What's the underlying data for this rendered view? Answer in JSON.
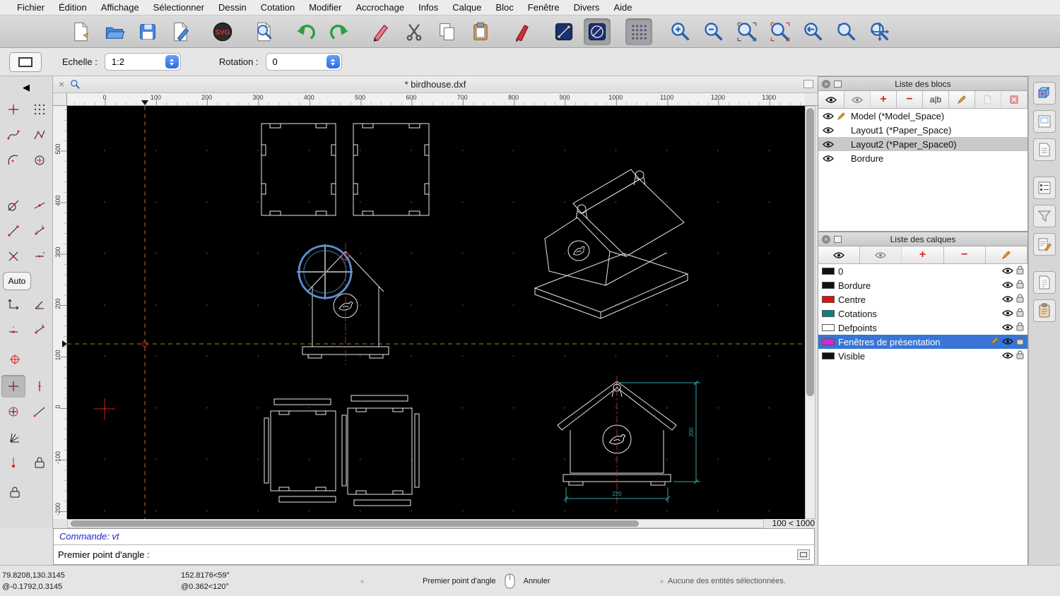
{
  "colors": {
    "accent_blue": "#3478f6",
    "selection_blue": "#3875d7",
    "canvas_bg": "#000000",
    "line_white": "#e8e8e8",
    "dim_cyan": "#2fa8a8",
    "center_red": "#cc3333",
    "construction_orange": "#b97425",
    "snap_blue": "#5f93d8"
  },
  "menubar": {
    "items": [
      "Fichier",
      "Édition",
      "Affichage",
      "Sélectionner",
      "Dessin",
      "Cotation",
      "Modifier",
      "Accrochage",
      "Infos",
      "Calque",
      "Bloc",
      "Fenêtre",
      "Divers",
      "Aide"
    ]
  },
  "glyphs": {
    "svg_badge": "SVG",
    "back_arrow": "◀",
    "plus": "+",
    "minus": "−",
    "rename": "a|b",
    "close": "×",
    "auto": "Auto"
  },
  "options_bar": {
    "scale_label": "Echelle :",
    "scale_value": "1:2",
    "rotation_label": "Rotation :",
    "rotation_value": "0"
  },
  "document": {
    "tab_title": "* birdhouse.dxf",
    "zoom_range": "100 < 1000"
  },
  "rulers": {
    "horizontal": [
      "0",
      "100",
      "200",
      "300",
      "400",
      "500",
      "600",
      "700",
      "800",
      "900",
      "1000",
      "1100",
      "1200",
      "1300"
    ],
    "vertical": [
      "500",
      "400",
      "300",
      "200",
      "100",
      "0",
      "-100",
      "-200"
    ]
  },
  "drawing": {
    "dim_width": "220",
    "dim_height": "200"
  },
  "blocks_panel": {
    "title": "Liste des blocs",
    "rows": [
      {
        "label": "Model (*Model_Space)",
        "pencil": true
      },
      {
        "label": "Layout1 (*Paper_Space)"
      },
      {
        "label": "Layout2 (*Paper_Space0)",
        "selected": true
      },
      {
        "label": "Bordure"
      }
    ]
  },
  "layers_panel": {
    "title": "Liste des calques",
    "rows": [
      {
        "label": "0",
        "color": "#111111"
      },
      {
        "label": "Bordure",
        "color": "#111111"
      },
      {
        "label": "Centre",
        "color": "#e01010"
      },
      {
        "label": "Cotations",
        "color": "#0e8080"
      },
      {
        "label": "Defpoints",
        "color": "#ffffff"
      },
      {
        "label": "Fenêtres de présentation",
        "color": "#dd22dd",
        "selected": true,
        "pencil": true
      },
      {
        "label": "Visible",
        "color": "#111111"
      }
    ]
  },
  "command": {
    "history": "Commande: vt",
    "prompt_label": "Premier point d'angle :"
  },
  "statusbar": {
    "abs_coord": "79.8208,130.3145",
    "rel_coord": "@-0.1792,0.3145",
    "abs_polar": "152.8176<59°",
    "rel_polar": "@0.362<120°",
    "left_hint": "Premier point d'angle",
    "right_hint": "Annuler",
    "selection_info": "Aucune des entités sélectionnées."
  }
}
